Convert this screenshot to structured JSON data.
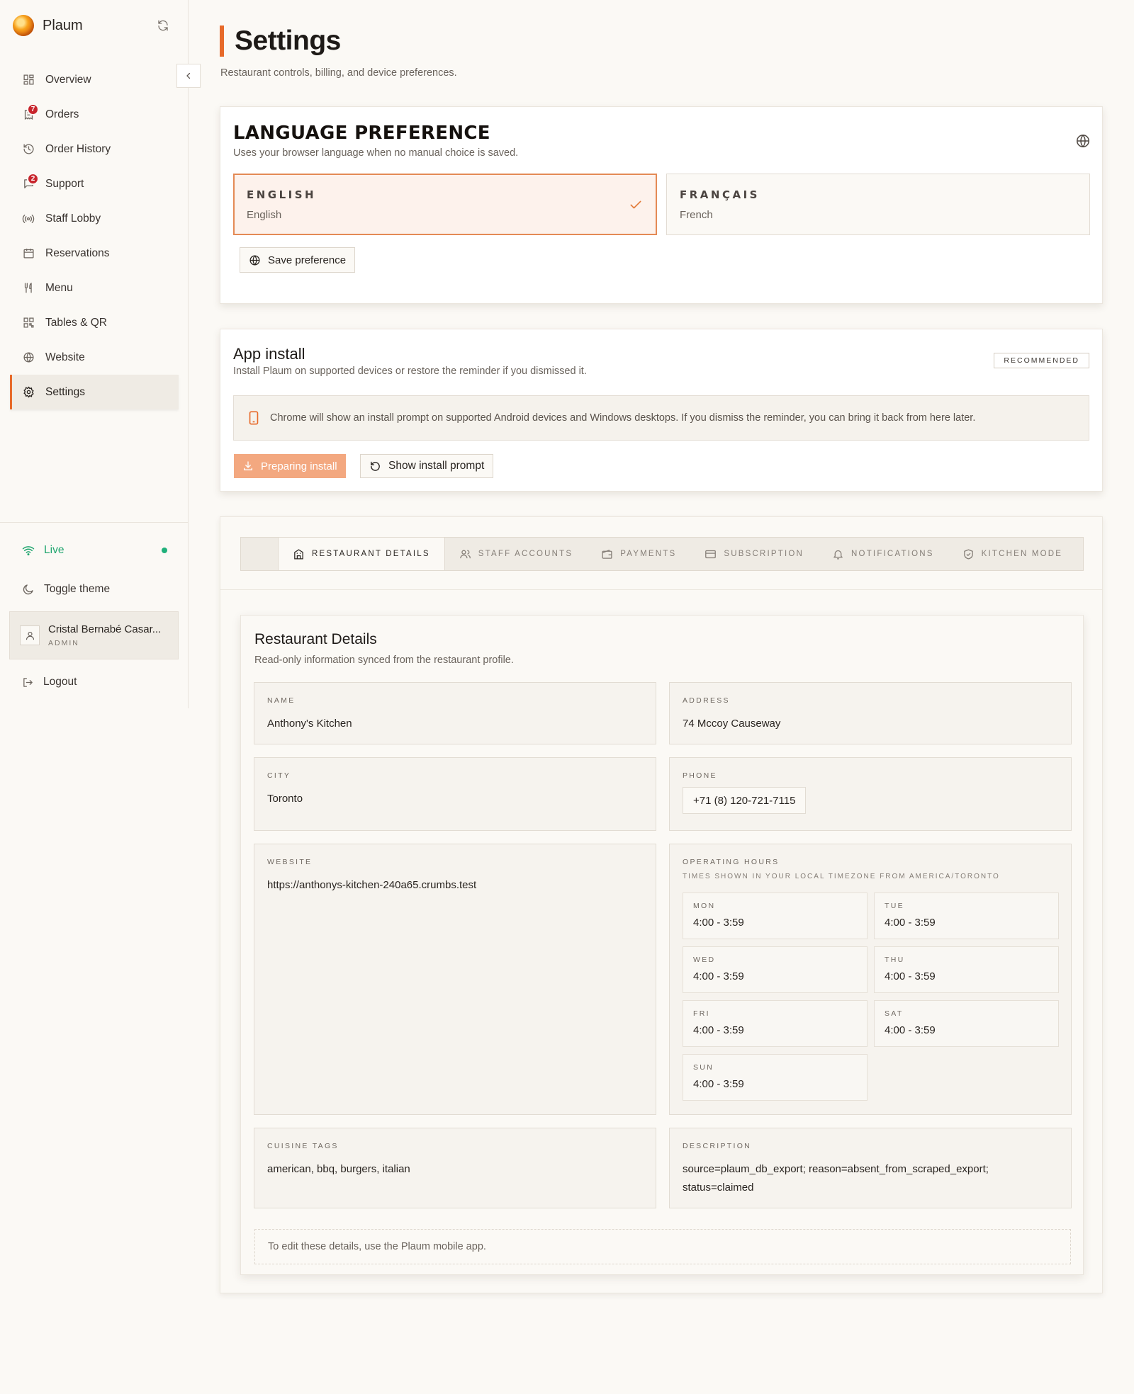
{
  "app": {
    "name": "Plaum"
  },
  "sidebar": {
    "items": [
      {
        "label": "Overview",
        "icon": "grid-icon"
      },
      {
        "label": "Orders",
        "icon": "orders-icon",
        "badge": "7"
      },
      {
        "label": "Order History",
        "icon": "history-icon"
      },
      {
        "label": "Support",
        "icon": "chat-icon",
        "badge": "2"
      },
      {
        "label": "Staff Lobby",
        "icon": "broadcast-icon"
      },
      {
        "label": "Reservations",
        "icon": "calendar-icon"
      },
      {
        "label": "Menu",
        "icon": "utensils-icon"
      },
      {
        "label": "Tables & QR",
        "icon": "qr-icon"
      },
      {
        "label": "Website",
        "icon": "globe-icon"
      },
      {
        "label": "Settings",
        "icon": "gear-icon",
        "active": true
      }
    ],
    "status": "Live",
    "toggle_theme": "Toggle theme",
    "user": {
      "name": "Cristal Bernabé Casar...",
      "role": "ADMIN"
    },
    "logout": "Logout"
  },
  "page": {
    "title": "Settings",
    "subtitle": "Restaurant controls, billing, and device preferences."
  },
  "language": {
    "title": "LANGUAGE PREFERENCE",
    "subtitle": "Uses your browser language when no manual choice is saved.",
    "options": [
      {
        "code": "ENGLISH",
        "name": "English",
        "selected": true
      },
      {
        "code": "FRANÇAIS",
        "name": "French",
        "selected": false
      }
    ],
    "save_label": "Save preference"
  },
  "app_install": {
    "title": "App install",
    "subtitle": "Install Plaum on supported devices or restore the reminder if you dismissed it.",
    "badge": "RECOMMENDED",
    "note": "Chrome will show an install prompt on supported Android devices and Windows desktops. If you dismiss the reminder, you can bring it back from here later.",
    "preparing_label": "Preparing install",
    "show_label": "Show install prompt"
  },
  "tabs": [
    {
      "label": "RESTAURANT DETAILS",
      "icon": "building-icon",
      "active": true
    },
    {
      "label": "STAFF ACCOUNTS",
      "icon": "users-icon"
    },
    {
      "label": "PAYMENTS",
      "icon": "wallet-icon"
    },
    {
      "label": "SUBSCRIPTION",
      "icon": "card-icon"
    },
    {
      "label": "NOTIFICATIONS",
      "icon": "bell-icon"
    },
    {
      "label": "KITCHEN MODE",
      "icon": "shield-icon"
    }
  ],
  "details": {
    "title": "Restaurant Details",
    "subtitle": "Read-only information synced from the restaurant profile.",
    "name": {
      "label": "NAME",
      "value": "Anthony's Kitchen"
    },
    "address": {
      "label": "ADDRESS",
      "value": "74 Mccoy Causeway"
    },
    "city": {
      "label": "CITY",
      "value": "Toronto"
    },
    "phone": {
      "label": "PHONE",
      "value": "+71 (8) 120-721-7115"
    },
    "website": {
      "label": "WEBSITE",
      "value": "https://anthonys-kitchen-240a65.crumbs.test"
    },
    "hours": {
      "label": "OPERATING HOURS",
      "sub": "TIMES SHOWN IN YOUR LOCAL TIMEZONE FROM AMERICA/TORONTO",
      "days": [
        {
          "day": "MON",
          "time": "4:00 - 3:59"
        },
        {
          "day": "TUE",
          "time": "4:00 - 3:59"
        },
        {
          "day": "WED",
          "time": "4:00 - 3:59"
        },
        {
          "day": "THU",
          "time": "4:00 - 3:59"
        },
        {
          "day": "FRI",
          "time": "4:00 - 3:59"
        },
        {
          "day": "SAT",
          "time": "4:00 - 3:59"
        },
        {
          "day": "SUN",
          "time": "4:00 - 3:59"
        }
      ]
    },
    "cuisine": {
      "label": "CUISINE TAGS",
      "value": "american, bbq, burgers, italian"
    },
    "description": {
      "label": "DESCRIPTION",
      "value": "source=plaum_db_export; reason=absent_from_scraped_export; status=claimed"
    },
    "edit_note": "To edit these details, use the Plaum mobile app."
  },
  "colors": {
    "accent": "#e76a2a",
    "live": "#1fa56e",
    "badge": "#c8252c"
  }
}
